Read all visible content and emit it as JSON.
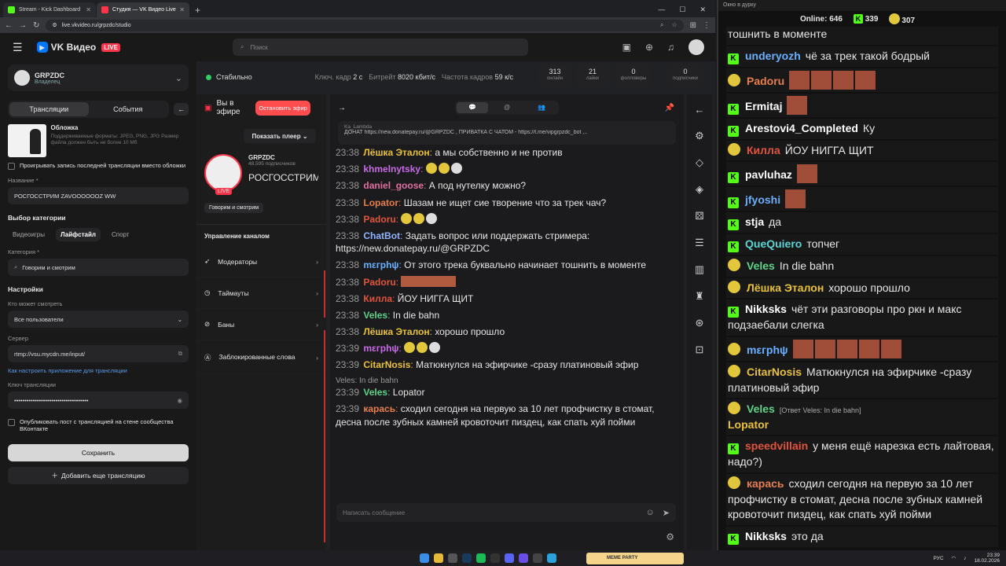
{
  "browser": {
    "tabs": [
      {
        "title": "Stream - Kick Dashboard",
        "color": "#53fc18",
        "active": false
      },
      {
        "title": "Студия — VK Видео Live",
        "color": "#ff3347",
        "active": true
      }
    ],
    "new_tab": "+",
    "url": "live.vkvideo.ru/grpzdc/studio"
  },
  "vk": {
    "logo": "VK Видео",
    "live": "LIVE",
    "search_placeholder": "Поиск",
    "channel": {
      "name": "GRPZDC",
      "role": "Владелец"
    },
    "tabs": [
      "Трансляции",
      "События"
    ],
    "cover": {
      "title": "Обложка",
      "hint": "Поддерживаемые форматы: JPEG, PNG, JPG Размер файла должен быть не более 10 Мб"
    },
    "replay_label": "Проигрывать запись последней трансляции вместо обложки",
    "name_label": "Название *",
    "name_value": "РОСГОССТРИМ ZAVOOOOOOZ WW",
    "category_section": "Выбор категории",
    "cat_tabs": [
      "Видеоигры",
      "Лайфстайл",
      "Спорт"
    ],
    "category_label": "Категория *",
    "category_value": "Говорим и смотрим",
    "settings_section": "Настройки",
    "who_label": "Кто может смотреть",
    "who_value": "Все пользователи",
    "server_label": "Сервер",
    "server_value": "rtmp://vsu.mycdn.me/input/",
    "howto_link": "Как настроить приложение для трансляции",
    "key_label": "Ключ трансляции",
    "key_value": "••••••••••••••••••••••••••••••••••••",
    "publish_label": "Опубликовать пост с трансляцией на стене сообщества ВКонтакте",
    "save": "Сохранить",
    "add": "Добавить еще трансляцию",
    "status": "Стабильно",
    "key_frame": "Ключ. кадр",
    "key_frame_val": "2 с",
    "bitrate": "Битрейт",
    "bitrate_val": "8020 кбит/с",
    "fps": "Частота кадров",
    "fps_val": "59 к/с",
    "stats": [
      {
        "v": "313",
        "l": "онлайн"
      },
      {
        "v": "21",
        "l": "лайки"
      },
      {
        "v": "0",
        "l": "фолловеры"
      },
      {
        "v": "0",
        "l": "подписчики"
      }
    ],
    "on_air": "Вы в эфире",
    "stop": "Остановить эфир",
    "show_player": "Показать плеер",
    "stream_channel": "GRPZDC",
    "subs": "48,595 подписчиков",
    "stream_title": "РОСГОССТРИМ ZAVOOOOOOZ WW",
    "category_pill": "Говорим и смотрим",
    "manage": "Управление каналом",
    "manage_items": [
      "Модераторы",
      "Таймауты",
      "Баны",
      "Заблокированные слова"
    ]
  },
  "chat": {
    "pin_user": "Ka_Lambda",
    "pin_text": "ДОНАТ https://new.donatepay.ru/@GRPZDC , ПРИВАТКА С ЧАТОМ - https://t.me/vipgrpzdc_bot ,..",
    "placeholder": "Написать сообщение",
    "messages": [
      {
        "t": "23:38",
        "u": "Лёшка Эталон",
        "c": "#e8c23a",
        "m": "а мы собственно и не против"
      },
      {
        "t": "23:38",
        "u": "khmelnytsky",
        "c": "#c86be8",
        "m": ""
      },
      {
        "t": "23:38",
        "u": "daniel_goose",
        "c": "#e06fa2",
        "m": "А под нутелку можно?"
      },
      {
        "t": "23:38",
        "u": "Lopator",
        "c": "#e67e4d",
        "m": "Шазам не ищет сие творение что за трек чач?"
      },
      {
        "t": "23:38",
        "u": "Padoru",
        "c": "#e2553b",
        "m": ""
      },
      {
        "t": "23:38",
        "u": "ChatBot",
        "c": "#8fb4ff",
        "m": "Задать вопрос или поддержать стримера: https://new.donatepay.ru/@GRPZDC"
      },
      {
        "t": "23:38",
        "u": "mεгрhψ",
        "c": "#6ab0ff",
        "m": "От этого трека буквально начинает тошнить в моменте"
      },
      {
        "t": "23:38",
        "u": "Padoru",
        "c": "#e2553b",
        "m": ""
      },
      {
        "t": "23:38",
        "u": "Килла",
        "c": "#e2553b",
        "m": "ЙОУ НИГГА ЩИТ"
      },
      {
        "t": "23:38",
        "u": "Veles",
        "c": "#5fd38a",
        "m": "In die bahn"
      },
      {
        "t": "23:38",
        "u": "Лёшка Эталон",
        "c": "#e8c23a",
        "m": "хорошо прошло"
      },
      {
        "t": "23:39",
        "u": "mεгрhψ",
        "c": "#c86be8",
        "m": ""
      },
      {
        "t": "23:39",
        "u": "CitarNosis",
        "c": "#e8c23a",
        "m": "Матюкнулся на эфирчике -сразу платиновый эфир"
      },
      {
        "t": "23:39",
        "u": "Veles",
        "c": "#5fd38a",
        "m": "Lopator",
        "reply": "Veles: In die bahn"
      },
      {
        "t": "23:39",
        "u": "карась",
        "c": "#e67e4d",
        "m": "сходил сегодня на первую за 10 лет профчистку в стомат, десна после зубных камней кровоточит пиздец, как спать хуй пойми"
      }
    ]
  },
  "overlay": {
    "title": "Окно в дурку",
    "online_label": "Online:",
    "online": "646",
    "kick_count": "339",
    "vk_count": "307",
    "top_text": "тошнить в моменте",
    "messages": [
      {
        "u": "underyozh",
        "c": "#6ab0ff",
        "m": "чё за трек такой бодрый",
        "src": "k"
      },
      {
        "u": "Padoru",
        "c": "#e67e4d",
        "m": "",
        "src": "v"
      },
      {
        "u": "Ermitaj",
        "c": "#ffffff",
        "m": "",
        "src": "k"
      },
      {
        "u": "Arestovi4_Completed",
        "c": "#ffffff",
        "m": "Ку",
        "src": "k"
      },
      {
        "u": "Килла",
        "c": "#e2553b",
        "m": "ЙОУ НИГГА ЩИТ",
        "src": "v"
      },
      {
        "u": "pavluhaz",
        "c": "#ffffff",
        "m": "",
        "src": "k"
      },
      {
        "u": "jfyoshi",
        "c": "#6ab0ff",
        "m": "",
        "src": "k"
      },
      {
        "u": "stja",
        "c": "#ffffff",
        "m": "да",
        "src": "k"
      },
      {
        "u": "QueQuiero",
        "c": "#5fd3d3",
        "m": "топчег",
        "src": "k"
      },
      {
        "u": "Veles",
        "c": "#5fd38a",
        "m": "In die bahn",
        "src": "v"
      },
      {
        "u": "Лёшка Эталон",
        "c": "#e8c23a",
        "m": "хорошо прошло",
        "src": "v"
      },
      {
        "u": "Nikksks",
        "c": "#ffffff",
        "m": "чёт эти разговоры про ркн и макс подзаебали слегка",
        "src": "k"
      },
      {
        "u": "mεгрhψ",
        "c": "#6ab0ff",
        "m": "",
        "src": "v"
      },
      {
        "u": "CitarNosis",
        "c": "#e8c23a",
        "m": "Матюкнулся на эфирчике -сразу платиновый эфир",
        "src": "v"
      },
      {
        "u": "Veles",
        "c": "#5fd38a",
        "m": "Lopator",
        "src": "v",
        "reply": "[Ответ Veles: In die bahn]"
      },
      {
        "u": "speedvillain",
        "c": "#e2553b",
        "m": "у меня ещё нарезка есть лайтовая, надо?)",
        "src": "k"
      },
      {
        "u": "карась",
        "c": "#e67e4d",
        "m": "сходил сегодня на первую за 10 лет профчистку в стомат, десна после зубных камней кровоточит пиздец, как спать хуй пойми",
        "src": "v"
      },
      {
        "u": "Nikksks",
        "c": "#ffffff",
        "m": "это да",
        "src": "k"
      }
    ]
  },
  "taskbar": {
    "meme_label": "MEME PARTY",
    "lang": "РУС",
    "time": "23:39",
    "date": "18.02.2026"
  }
}
